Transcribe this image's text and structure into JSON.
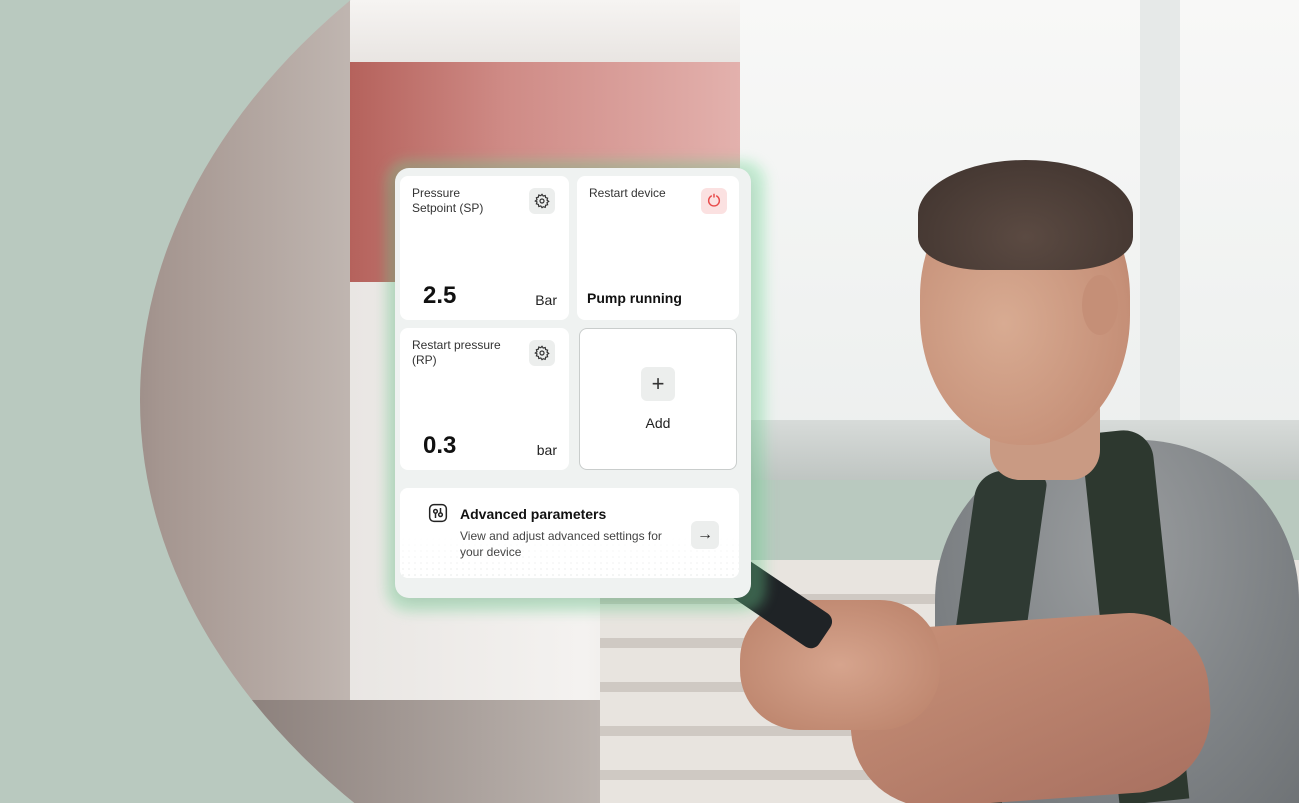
{
  "widgets": {
    "pressure_setpoint": {
      "label": "Pressure Setpoint (SP)",
      "value": "2.5",
      "unit": "Bar"
    },
    "restart_device": {
      "label": "Restart device",
      "status": "Pump running"
    },
    "restart_pressure": {
      "label": "Restart pressure (RP)",
      "value": "0.3",
      "unit": "bar"
    },
    "add": {
      "icon": "+",
      "label": "Add"
    }
  },
  "advanced": {
    "title": "Advanced parameters",
    "description": "View and adjust advanced settings for your device",
    "arrow": "→"
  },
  "colors": {
    "background": "#b9c9bf",
    "glow": "#78e6a0",
    "restart_accent": "#e84a4a"
  },
  "icons": {
    "settings": "gear-icon",
    "restart": "restart-icon",
    "advanced": "sliders-icon",
    "arrow": "arrow-right-icon"
  }
}
